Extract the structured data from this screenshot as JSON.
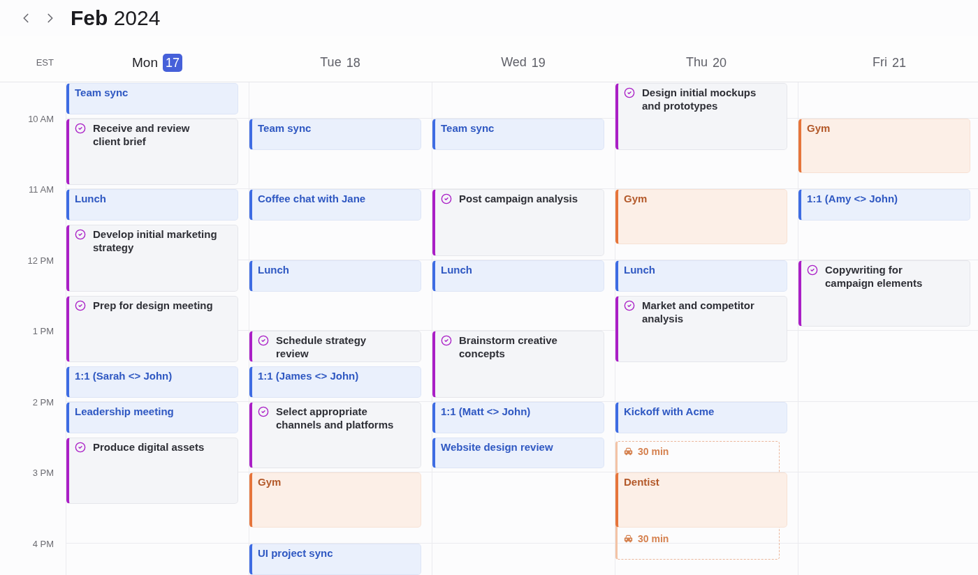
{
  "title": "**Feb** 2024",
  "timezone": "EST",
  "hours": [
    "10 AM",
    "11 AM",
    "12 PM",
    "1 PM",
    "2 PM",
    "3 PM",
    "4 PM"
  ],
  "days": [
    {
      "weekday": "Mon",
      "date": "17",
      "today": true,
      "events": [
        {
          "kind": "meeting",
          "title": "Team sync"
        },
        {
          "kind": "task",
          "title": "Receive and review\nclient brief"
        },
        {
          "kind": "meeting",
          "title": "Lunch"
        },
        {
          "kind": "task",
          "title": "Develop initial marketing\nstrategy"
        },
        {
          "kind": "task",
          "title": "Prep for design meeting"
        },
        {
          "kind": "meeting",
          "title": "1:1 (Sarah <> John)"
        },
        {
          "kind": "meeting",
          "title": "Leadership meeting"
        },
        {
          "kind": "task",
          "title": "Produce digital assets"
        }
      ]
    },
    {
      "weekday": "Tue",
      "date": "18",
      "today": false,
      "events": [
        {
          "kind": "meeting",
          "title": "Team sync"
        },
        {
          "kind": "meeting",
          "title": "Coffee chat with Jane"
        },
        {
          "kind": "meeting",
          "title": "Lunch"
        },
        {
          "kind": "task",
          "title": "Schedule strategy\nreview"
        },
        {
          "kind": "meeting",
          "title": "1:1 (James <> John)"
        },
        {
          "kind": "task",
          "title": "Select appropriate\nchannels and platforms"
        },
        {
          "kind": "personal",
          "title": "Gym"
        },
        {
          "kind": "meeting",
          "title": "UI project sync"
        }
      ]
    },
    {
      "weekday": "Wed",
      "date": "19",
      "today": false,
      "events": [
        {
          "kind": "meeting",
          "title": "Team sync"
        },
        {
          "kind": "task",
          "title": "Post campaign analysis"
        },
        {
          "kind": "meeting",
          "title": "Lunch"
        },
        {
          "kind": "task",
          "title": "Brainstorm creative\nconcepts"
        },
        {
          "kind": "meeting",
          "title": "1:1 (Matt <> John)"
        },
        {
          "kind": "meeting",
          "title": "Website design review"
        }
      ]
    },
    {
      "weekday": "Thu",
      "date": "20",
      "today": false,
      "events": [
        {
          "kind": "task",
          "title": "Design initial mockups\nand prototypes"
        },
        {
          "kind": "personal",
          "title": "Gym"
        },
        {
          "kind": "meeting",
          "title": "Lunch"
        },
        {
          "kind": "task",
          "title": "Market and competitor\nanalysis"
        },
        {
          "kind": "meeting",
          "title": "Kickoff with Acme"
        },
        {
          "kind": "personal",
          "title": "Dentist",
          "travel_before": "30 min",
          "travel_after": "30 min"
        }
      ]
    },
    {
      "weekday": "Fri",
      "date": "21",
      "today": false,
      "events": [
        {
          "kind": "personal",
          "title": "Gym"
        },
        {
          "kind": "meeting",
          "title": "1:1 (Amy <> John)"
        },
        {
          "kind": "task",
          "title": "Copywriting for\ncampaign elements"
        }
      ]
    }
  ]
}
